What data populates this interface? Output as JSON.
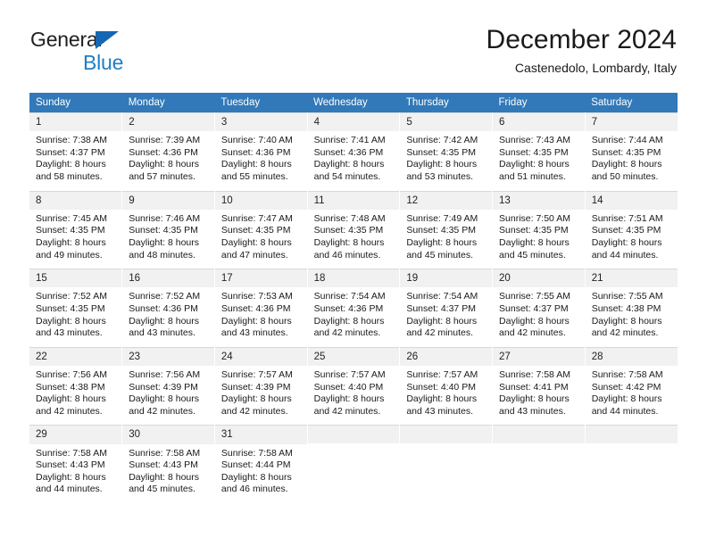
{
  "brand": {
    "name_part1": "General",
    "name_part2": "Blue",
    "triangle_icon": "triangle-icon"
  },
  "header": {
    "title": "December 2024",
    "subtitle": "Castenedolo, Lombardy, Italy"
  },
  "calendar": {
    "weekday_headers": [
      "Sunday",
      "Monday",
      "Tuesday",
      "Wednesday",
      "Thursday",
      "Friday",
      "Saturday"
    ],
    "colors": {
      "header_blue": "#3179b9",
      "daynum_band": "#f1f1f1",
      "row_divider": "#d8d8d8",
      "brand_blue": "#1f7ec4"
    },
    "weeks": [
      {
        "days": [
          {
            "num": "1",
            "sunrise": "Sunrise: 7:38 AM",
            "sunset": "Sunset: 4:37 PM",
            "daylight1": "Daylight: 8 hours",
            "daylight2": "and 58 minutes."
          },
          {
            "num": "2",
            "sunrise": "Sunrise: 7:39 AM",
            "sunset": "Sunset: 4:36 PM",
            "daylight1": "Daylight: 8 hours",
            "daylight2": "and 57 minutes."
          },
          {
            "num": "3",
            "sunrise": "Sunrise: 7:40 AM",
            "sunset": "Sunset: 4:36 PM",
            "daylight1": "Daylight: 8 hours",
            "daylight2": "and 55 minutes."
          },
          {
            "num": "4",
            "sunrise": "Sunrise: 7:41 AM",
            "sunset": "Sunset: 4:36 PM",
            "daylight1": "Daylight: 8 hours",
            "daylight2": "and 54 minutes."
          },
          {
            "num": "5",
            "sunrise": "Sunrise: 7:42 AM",
            "sunset": "Sunset: 4:35 PM",
            "daylight1": "Daylight: 8 hours",
            "daylight2": "and 53 minutes."
          },
          {
            "num": "6",
            "sunrise": "Sunrise: 7:43 AM",
            "sunset": "Sunset: 4:35 PM",
            "daylight1": "Daylight: 8 hours",
            "daylight2": "and 51 minutes."
          },
          {
            "num": "7",
            "sunrise": "Sunrise: 7:44 AM",
            "sunset": "Sunset: 4:35 PM",
            "daylight1": "Daylight: 8 hours",
            "daylight2": "and 50 minutes."
          }
        ]
      },
      {
        "days": [
          {
            "num": "8",
            "sunrise": "Sunrise: 7:45 AM",
            "sunset": "Sunset: 4:35 PM",
            "daylight1": "Daylight: 8 hours",
            "daylight2": "and 49 minutes."
          },
          {
            "num": "9",
            "sunrise": "Sunrise: 7:46 AM",
            "sunset": "Sunset: 4:35 PM",
            "daylight1": "Daylight: 8 hours",
            "daylight2": "and 48 minutes."
          },
          {
            "num": "10",
            "sunrise": "Sunrise: 7:47 AM",
            "sunset": "Sunset: 4:35 PM",
            "daylight1": "Daylight: 8 hours",
            "daylight2": "and 47 minutes."
          },
          {
            "num": "11",
            "sunrise": "Sunrise: 7:48 AM",
            "sunset": "Sunset: 4:35 PM",
            "daylight1": "Daylight: 8 hours",
            "daylight2": "and 46 minutes."
          },
          {
            "num": "12",
            "sunrise": "Sunrise: 7:49 AM",
            "sunset": "Sunset: 4:35 PM",
            "daylight1": "Daylight: 8 hours",
            "daylight2": "and 45 minutes."
          },
          {
            "num": "13",
            "sunrise": "Sunrise: 7:50 AM",
            "sunset": "Sunset: 4:35 PM",
            "daylight1": "Daylight: 8 hours",
            "daylight2": "and 45 minutes."
          },
          {
            "num": "14",
            "sunrise": "Sunrise: 7:51 AM",
            "sunset": "Sunset: 4:35 PM",
            "daylight1": "Daylight: 8 hours",
            "daylight2": "and 44 minutes."
          }
        ]
      },
      {
        "days": [
          {
            "num": "15",
            "sunrise": "Sunrise: 7:52 AM",
            "sunset": "Sunset: 4:35 PM",
            "daylight1": "Daylight: 8 hours",
            "daylight2": "and 43 minutes."
          },
          {
            "num": "16",
            "sunrise": "Sunrise: 7:52 AM",
            "sunset": "Sunset: 4:36 PM",
            "daylight1": "Daylight: 8 hours",
            "daylight2": "and 43 minutes."
          },
          {
            "num": "17",
            "sunrise": "Sunrise: 7:53 AM",
            "sunset": "Sunset: 4:36 PM",
            "daylight1": "Daylight: 8 hours",
            "daylight2": "and 43 minutes."
          },
          {
            "num": "18",
            "sunrise": "Sunrise: 7:54 AM",
            "sunset": "Sunset: 4:36 PM",
            "daylight1": "Daylight: 8 hours",
            "daylight2": "and 42 minutes."
          },
          {
            "num": "19",
            "sunrise": "Sunrise: 7:54 AM",
            "sunset": "Sunset: 4:37 PM",
            "daylight1": "Daylight: 8 hours",
            "daylight2": "and 42 minutes."
          },
          {
            "num": "20",
            "sunrise": "Sunrise: 7:55 AM",
            "sunset": "Sunset: 4:37 PM",
            "daylight1": "Daylight: 8 hours",
            "daylight2": "and 42 minutes."
          },
          {
            "num": "21",
            "sunrise": "Sunrise: 7:55 AM",
            "sunset": "Sunset: 4:38 PM",
            "daylight1": "Daylight: 8 hours",
            "daylight2": "and 42 minutes."
          }
        ]
      },
      {
        "days": [
          {
            "num": "22",
            "sunrise": "Sunrise: 7:56 AM",
            "sunset": "Sunset: 4:38 PM",
            "daylight1": "Daylight: 8 hours",
            "daylight2": "and 42 minutes."
          },
          {
            "num": "23",
            "sunrise": "Sunrise: 7:56 AM",
            "sunset": "Sunset: 4:39 PM",
            "daylight1": "Daylight: 8 hours",
            "daylight2": "and 42 minutes."
          },
          {
            "num": "24",
            "sunrise": "Sunrise: 7:57 AM",
            "sunset": "Sunset: 4:39 PM",
            "daylight1": "Daylight: 8 hours",
            "daylight2": "and 42 minutes."
          },
          {
            "num": "25",
            "sunrise": "Sunrise: 7:57 AM",
            "sunset": "Sunset: 4:40 PM",
            "daylight1": "Daylight: 8 hours",
            "daylight2": "and 42 minutes."
          },
          {
            "num": "26",
            "sunrise": "Sunrise: 7:57 AM",
            "sunset": "Sunset: 4:40 PM",
            "daylight1": "Daylight: 8 hours",
            "daylight2": "and 43 minutes."
          },
          {
            "num": "27",
            "sunrise": "Sunrise: 7:58 AM",
            "sunset": "Sunset: 4:41 PM",
            "daylight1": "Daylight: 8 hours",
            "daylight2": "and 43 minutes."
          },
          {
            "num": "28",
            "sunrise": "Sunrise: 7:58 AM",
            "sunset": "Sunset: 4:42 PM",
            "daylight1": "Daylight: 8 hours",
            "daylight2": "and 44 minutes."
          }
        ]
      },
      {
        "days": [
          {
            "num": "29",
            "sunrise": "Sunrise: 7:58 AM",
            "sunset": "Sunset: 4:43 PM",
            "daylight1": "Daylight: 8 hours",
            "daylight2": "and 44 minutes."
          },
          {
            "num": "30",
            "sunrise": "Sunrise: 7:58 AM",
            "sunset": "Sunset: 4:43 PM",
            "daylight1": "Daylight: 8 hours",
            "daylight2": "and 45 minutes."
          },
          {
            "num": "31",
            "sunrise": "Sunrise: 7:58 AM",
            "sunset": "Sunset: 4:44 PM",
            "daylight1": "Daylight: 8 hours",
            "daylight2": "and 46 minutes."
          },
          {
            "num": "",
            "sunrise": "",
            "sunset": "",
            "daylight1": "",
            "daylight2": ""
          },
          {
            "num": "",
            "sunrise": "",
            "sunset": "",
            "daylight1": "",
            "daylight2": ""
          },
          {
            "num": "",
            "sunrise": "",
            "sunset": "",
            "daylight1": "",
            "daylight2": ""
          },
          {
            "num": "",
            "sunrise": "",
            "sunset": "",
            "daylight1": "",
            "daylight2": ""
          }
        ]
      }
    ]
  }
}
